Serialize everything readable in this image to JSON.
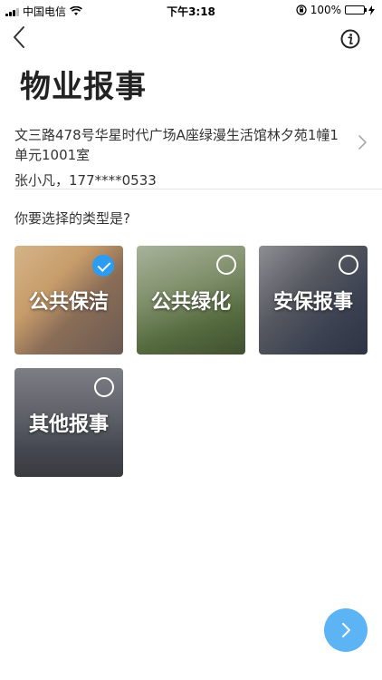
{
  "status_bar": {
    "carrier": "中国电信",
    "time": "下午3:18",
    "battery": "100%",
    "icons": [
      "signal-icon",
      "wifi-icon",
      "orientation-lock-icon",
      "battery-icon",
      "charging-icon"
    ]
  },
  "nav": {
    "back_icon": "chevron-left-icon",
    "info_icon": "info-icon"
  },
  "page_title": "物业报事",
  "address": {
    "line": "文三路478号华星时代广场A座绿漫生活馆林夕苑1幢1单元1001室",
    "contact": "张小凡，177****0533"
  },
  "question": "你要选择的类型是?",
  "types": [
    {
      "label": "公共保洁",
      "selected": true
    },
    {
      "label": "公共绿化",
      "selected": false
    },
    {
      "label": "安保报事",
      "selected": false
    },
    {
      "label": "其他报事",
      "selected": false
    }
  ],
  "colors": {
    "accent": "#2b9cf2",
    "fab": "#5cb4f5"
  }
}
